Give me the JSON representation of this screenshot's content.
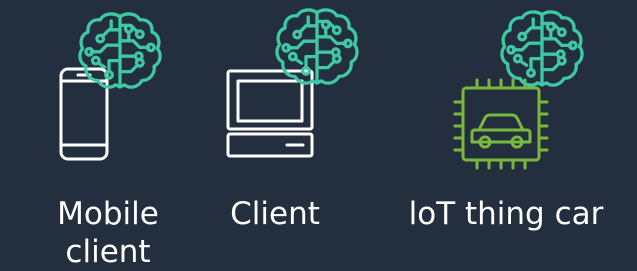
{
  "colors": {
    "background": "#232f3e",
    "ml_brain": "#3ec8a4",
    "device_outline": "#ffffff",
    "iot_chip": "#7ab83d",
    "caption_text": "#ffffff"
  },
  "items": [
    {
      "device_icon": "mobile-phone-icon",
      "ml_icon": "brain-circuit-icon",
      "caption_line1": "Mobile",
      "caption_line2": "client"
    },
    {
      "device_icon": "desktop-computer-icon",
      "ml_icon": "brain-circuit-icon",
      "caption_line1": "Client"
    },
    {
      "device_icon": "iot-chip-car-icon",
      "ml_icon": "brain-circuit-icon",
      "caption_line1": "loT thing car"
    }
  ]
}
